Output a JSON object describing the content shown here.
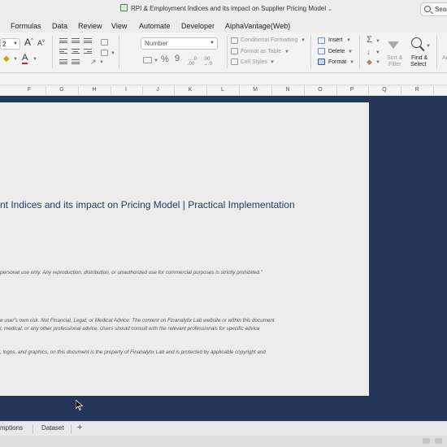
{
  "window": {
    "title": "RPI & Employment Indices and its impact on Supplier Pricing Model",
    "search_label": "Sear"
  },
  "menu": [
    "Formulas",
    "Data",
    "Review",
    "View",
    "Automate",
    "Developer",
    "AlphaVantage(Web)"
  ],
  "ribbon": {
    "font_size": "2",
    "number_format": "Number",
    "styles": {
      "conditional": "Conditional Formatting",
      "table": "Format as Table",
      "cell_styles": "Cell Styles"
    },
    "cells": {
      "insert": "Insert",
      "delete": "Delete",
      "format": "Format"
    },
    "editing": {
      "sort_line1": "Sort &",
      "sort_line2": "Filter",
      "find_line1": "Find &",
      "find_line2": "Select",
      "partial": "Ac"
    }
  },
  "columns": [
    "F",
    "G",
    "H",
    "I",
    "J",
    "K",
    "L",
    "M",
    "N",
    "O",
    "P",
    "Q",
    "R"
  ],
  "document": {
    "heading": "nt Indices and its impact on Pricing Model  |  Practical Implementation",
    "line1": "personal use only. Any reproduction, distribution, or unauthorized use for commercial purposes is strictly prohibited.\"",
    "line2": "e user's own risk. Not Financial, Legal, or Medical Advice: The content on Finanalytix Lab website or within this document",
    "line3": "l, medical, or any other professional advice. Users should consult with the relevant professionals for specific advice",
    "line4": ", logos, and graphics, on this document is the property of Finanalytix Lab and is protected by applicable copyright and"
  },
  "sheet_tabs": {
    "tab1": "mptions",
    "tab2": "Dataset",
    "add": "+"
  },
  "colors": {
    "sheet_background": "#243659",
    "heading": "#1f3f66"
  }
}
